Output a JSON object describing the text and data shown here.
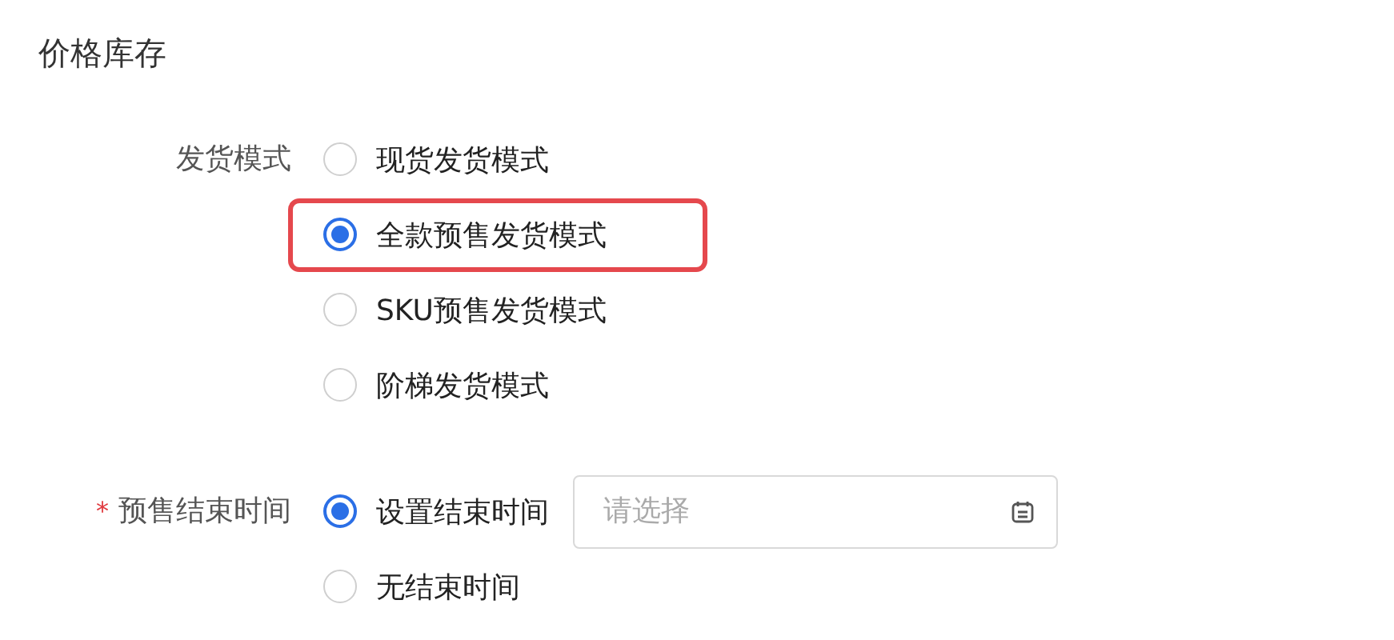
{
  "section": {
    "title": "价格库存"
  },
  "fields": [
    {
      "label": "发货模式",
      "required": false,
      "options": [
        {
          "label": "现货发货模式",
          "selected": false,
          "highlighted": false
        },
        {
          "label": "全款预售发货模式",
          "selected": true,
          "highlighted": true
        },
        {
          "label": "SKU预售发货模式",
          "selected": false,
          "highlighted": false
        },
        {
          "label": "阶梯发货模式",
          "selected": false,
          "highlighted": false
        }
      ]
    },
    {
      "label": "预售结束时间",
      "required": true,
      "options": [
        {
          "label": "设置结束时间",
          "selected": true,
          "highlighted": false,
          "date_field": {
            "placeholder": "请选择"
          }
        },
        {
          "label": "无结束时间",
          "selected": false,
          "highlighted": false
        }
      ]
    }
  ],
  "required_mark": "*"
}
